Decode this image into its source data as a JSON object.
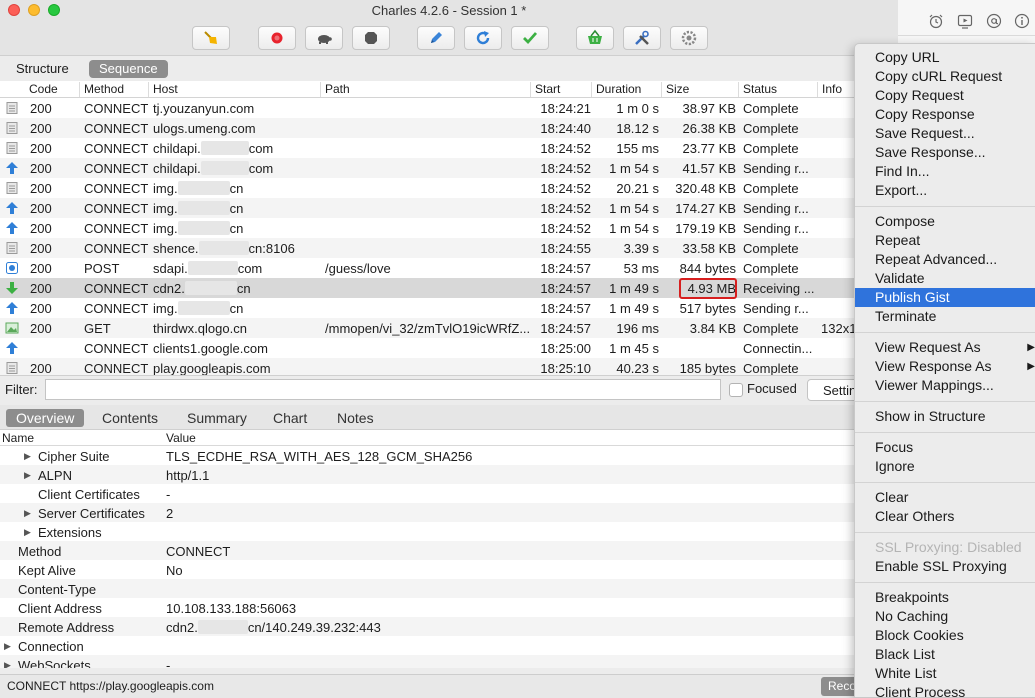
{
  "window": {
    "title": "Charles 4.2.6 - Session 1 *"
  },
  "toolbar": {
    "buttons": [
      {
        "name": "broom-icon",
        "color": "#f5b400"
      },
      {
        "name": "record-icon",
        "color": "#e8232d"
      },
      {
        "name": "turtle-icon",
        "color": "#555555"
      },
      {
        "name": "stop-hexagon-icon",
        "color": "#555555"
      },
      {
        "name": "pen-icon",
        "color": "#3a84d8"
      },
      {
        "name": "refresh-icon",
        "color": "#2f7fd7"
      },
      {
        "name": "check-icon",
        "color": "#3cb043"
      },
      {
        "name": "basket-icon",
        "color": "#3cb043"
      },
      {
        "name": "tools-icon",
        "color": "#3a6fc1"
      },
      {
        "name": "settings-icon",
        "color": "#888888"
      }
    ]
  },
  "view_tabs": [
    "Structure",
    "Sequence"
  ],
  "table": {
    "columns": [
      "Code",
      "Method",
      "Host",
      "Path",
      "Start",
      "Duration",
      "Size",
      "Status",
      "Info"
    ],
    "rows": [
      {
        "icon": "doc-icon",
        "code": "200",
        "method": "CONNECT",
        "host_a": "tj.youzanyun.com",
        "host_b": "",
        "path": "",
        "start": "18:24:21",
        "duration": "1 m 0 s",
        "size": "38.97 KB",
        "status": "Complete",
        "info": ""
      },
      {
        "icon": "doc-icon",
        "code": "200",
        "method": "CONNECT",
        "host_a": "ulogs.umeng.com",
        "host_b": "",
        "path": "",
        "start": "18:24:40",
        "duration": "18.12 s",
        "size": "26.38 KB",
        "status": "Complete",
        "info": ""
      },
      {
        "icon": "doc-icon",
        "code": "200",
        "method": "CONNECT",
        "host_a": "childapi.",
        "host_b": "com",
        "path": "",
        "start": "18:24:52",
        "duration": "155 ms",
        "size": "23.77 KB",
        "status": "Complete",
        "info": ""
      },
      {
        "icon": "upload-arrow-icon",
        "code": "200",
        "method": "CONNECT",
        "host_a": "childapi.",
        "host_b": "com",
        "path": "",
        "start": "18:24:52",
        "duration": "1 m 54 s",
        "size": "41.57 KB",
        "status": "Sending r...",
        "info": ""
      },
      {
        "icon": "doc-icon",
        "code": "200",
        "method": "CONNECT",
        "host_a": "img.",
        "host_b": "cn",
        "path": "",
        "start": "18:24:52",
        "duration": "20.21 s",
        "size": "320.48 KB",
        "status": "Complete",
        "info": ""
      },
      {
        "icon": "upload-arrow-icon",
        "code": "200",
        "method": "CONNECT",
        "host_a": "img.",
        "host_b": "cn",
        "path": "",
        "start": "18:24:52",
        "duration": "1 m 54 s",
        "size": "174.27 KB",
        "status": "Sending r...",
        "info": ""
      },
      {
        "icon": "upload-arrow-icon",
        "code": "200",
        "method": "CONNECT",
        "host_a": "img.",
        "host_b": "cn",
        "path": "",
        "start": "18:24:52",
        "duration": "1 m 54 s",
        "size": "179.19 KB",
        "status": "Sending r...",
        "info": ""
      },
      {
        "icon": "doc-icon",
        "code": "200",
        "method": "CONNECT",
        "host_a": "shence.",
        "host_b": "cn:8106",
        "path": "",
        "start": "18:24:55",
        "duration": "3.39 s",
        "size": "33.58 KB",
        "status": "Complete",
        "info": ""
      },
      {
        "icon": "json-icon",
        "code": "200",
        "method": "POST",
        "host_a": "sdapi.",
        "host_b": "com",
        "path": "/guess/love",
        "start": "18:24:57",
        "duration": "53 ms",
        "size": "844 bytes",
        "status": "Complete",
        "info": ""
      },
      {
        "icon": "download-arrow-icon",
        "code": "200",
        "method": "CONNECT",
        "host_a": "cdn2.",
        "host_b": "cn",
        "path": "",
        "start": "18:24:57",
        "duration": "1 m 49 s",
        "size": "4.93 MB",
        "status": "Receiving ...",
        "info": ""
      },
      {
        "icon": "upload-arrow-icon",
        "code": "200",
        "method": "CONNECT",
        "host_a": "img.",
        "host_b": "cn",
        "path": "",
        "start": "18:24:57",
        "duration": "1 m 49 s",
        "size": "517 bytes",
        "status": "Sending r...",
        "info": ""
      },
      {
        "icon": "image-icon",
        "code": "200",
        "method": "GET",
        "host_a": "thirdwx.qlogo.cn",
        "host_b": "",
        "path": "/mmopen/vi_32/zmTvlO19icWRfZ...",
        "start": "18:24:57",
        "duration": "196 ms",
        "size": "3.84 KB",
        "status": "Complete",
        "info": "132x1"
      },
      {
        "icon": "upload-arrow-icon",
        "code": "",
        "method": "CONNECT",
        "host_a": "clients1.google.com",
        "host_b": "",
        "path": "",
        "start": "18:25:00",
        "duration": "1 m 45 s",
        "size": "",
        "status": "Connectin...",
        "info": ""
      },
      {
        "icon": "doc-icon",
        "code": "200",
        "method": "CONNECT",
        "host_a": "play.googleapis.com",
        "host_b": "",
        "path": "",
        "start": "18:25:10",
        "duration": "40.23 s",
        "size": "185 bytes",
        "status": "Complete",
        "info": ""
      }
    ]
  },
  "filter": {
    "label": "Filter:",
    "value": "",
    "focused_label": "Focused",
    "settings_label": "Settings"
  },
  "detail_tabs": [
    "Overview",
    "Contents",
    "Summary",
    "Chart",
    "Notes"
  ],
  "detail": {
    "columns": [
      "Name",
      "Value"
    ],
    "rows": [
      {
        "indent": 2,
        "expander": true,
        "name": "Cipher Suite",
        "value_a": "TLS_ECDHE_RSA_WITH_AES_128_GCM_SHA256",
        "value_b": ""
      },
      {
        "indent": 2,
        "expander": true,
        "name": "ALPN",
        "value_a": "http/1.1",
        "value_b": ""
      },
      {
        "indent": 2,
        "expander": false,
        "name": "Client Certificates",
        "value_a": "-",
        "value_b": ""
      },
      {
        "indent": 2,
        "expander": true,
        "name": "Server Certificates",
        "value_a": "2",
        "value_b": ""
      },
      {
        "indent": 2,
        "expander": true,
        "name": "Extensions",
        "value_a": "",
        "value_b": ""
      },
      {
        "indent": 1,
        "expander": false,
        "name": "Method",
        "value_a": "CONNECT",
        "value_b": ""
      },
      {
        "indent": 1,
        "expander": false,
        "name": "Kept Alive",
        "value_a": "No",
        "value_b": ""
      },
      {
        "indent": 1,
        "expander": false,
        "name": "Content-Type",
        "value_a": "",
        "value_b": ""
      },
      {
        "indent": 1,
        "expander": false,
        "name": "Client Address",
        "value_a": "10.108.133.188:56063",
        "value_b": ""
      },
      {
        "indent": 1,
        "expander": false,
        "name": "Remote Address",
        "value_a": "cdn2.",
        "value_b": "cn/140.249.39.232:443"
      },
      {
        "indent": 0,
        "expander": true,
        "name": "Connection",
        "value_a": "",
        "value_b": ""
      },
      {
        "indent": 0,
        "expander": true,
        "name": "WebSockets",
        "value_a": "-",
        "value_b": ""
      }
    ]
  },
  "statusbar": {
    "text": "CONNECT https://play.googleapis.com",
    "record_label": "Recording"
  },
  "right_strip": {
    "icons": [
      "alarm-clock-icon",
      "video-icon",
      "at-sign-icon",
      "info-icon"
    ]
  },
  "context_menu": {
    "groups": [
      [
        {
          "label": "Copy URL"
        },
        {
          "label": "Copy cURL Request"
        },
        {
          "label": "Copy Request"
        },
        {
          "label": "Copy Response"
        },
        {
          "label": "Save Request..."
        },
        {
          "label": "Save Response..."
        },
        {
          "label": "Find In..."
        },
        {
          "label": "Export..."
        }
      ],
      [
        {
          "label": "Compose"
        },
        {
          "label": "Repeat"
        },
        {
          "label": "Repeat Advanced..."
        },
        {
          "label": "Validate"
        },
        {
          "label": "Publish Gist",
          "highlighted": true
        },
        {
          "label": "Terminate"
        }
      ],
      [
        {
          "label": "View Request As",
          "submenu": true
        },
        {
          "label": "View Response As",
          "submenu": true
        },
        {
          "label": "Viewer Mappings..."
        }
      ],
      [
        {
          "label": "Show in Structure"
        }
      ],
      [
        {
          "label": "Focus"
        },
        {
          "label": "Ignore"
        }
      ],
      [
        {
          "label": "Clear"
        },
        {
          "label": "Clear Others"
        }
      ],
      [
        {
          "label": "SSL Proxying: Disabled",
          "disabled": true
        },
        {
          "label": "Enable SSL Proxying"
        }
      ],
      [
        {
          "label": "Breakpoints"
        },
        {
          "label": "No Caching"
        },
        {
          "label": "Block Cookies"
        },
        {
          "label": "Black List"
        },
        {
          "label": "White List"
        },
        {
          "label": "Client Process"
        }
      ]
    ]
  },
  "colors": {
    "menu_highlight": "#2f73dc",
    "size_outline": "#d71f1f",
    "active_tab": "#8d8d8d"
  }
}
